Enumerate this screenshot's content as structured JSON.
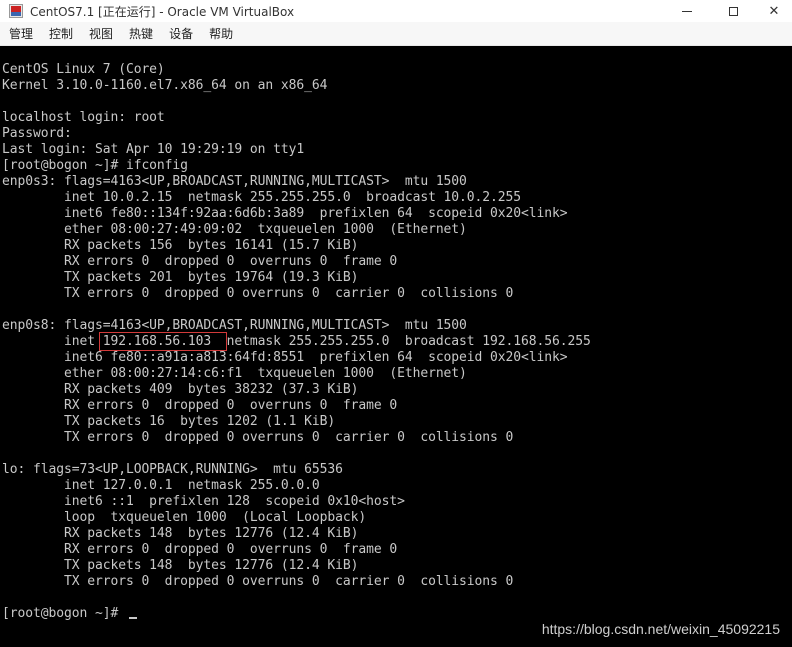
{
  "window": {
    "title": "CentOS7.1 [正在运行] - Oracle VM VirtualBox",
    "controls": {
      "minimize": "—",
      "maximize": "☐",
      "close": "✕"
    }
  },
  "menu": {
    "items": [
      "管理",
      "控制",
      "视图",
      "热键",
      "设备",
      "帮助"
    ]
  },
  "console": {
    "lines": [
      "CentOS Linux 7 (Core)",
      "Kernel 3.10.0-1160.el7.x86_64 on an x86_64",
      "",
      "localhost login: root",
      "Password:",
      "Last login: Sat Apr 10 19:29:19 on tty1",
      "[root@bogon ~]# ifconfig",
      "enp0s3: flags=4163<UP,BROADCAST,RUNNING,MULTICAST>  mtu 1500",
      "        inet 10.0.2.15  netmask 255.255.255.0  broadcast 10.0.2.255",
      "        inet6 fe80::134f:92aa:6d6b:3a89  prefixlen 64  scopeid 0x20<link>",
      "        ether 08:00:27:49:09:02  txqueuelen 1000  (Ethernet)",
      "        RX packets 156  bytes 16141 (15.7 KiB)",
      "        RX errors 0  dropped 0  overruns 0  frame 0",
      "        TX packets 201  bytes 19764 (19.3 KiB)",
      "        TX errors 0  dropped 0 overruns 0  carrier 0  collisions 0",
      "",
      "enp0s8: flags=4163<UP,BROADCAST,RUNNING,MULTICAST>  mtu 1500",
      "        inet 192.168.56.103  netmask 255.255.255.0  broadcast 192.168.56.255",
      "        inet6 fe80::a91a:a813:64fd:8551  prefixlen 64  scopeid 0x20<link>",
      "        ether 08:00:27:14:c6:f1  txqueuelen 1000  (Ethernet)",
      "        RX packets 409  bytes 38232 (37.3 KiB)",
      "        RX errors 0  dropped 0  overruns 0  frame 0",
      "        TX packets 16  bytes 1202 (1.1 KiB)",
      "        TX errors 0  dropped 0 overruns 0  carrier 0  collisions 0",
      "",
      "lo: flags=73<UP,LOOPBACK,RUNNING>  mtu 65536",
      "        inet 127.0.0.1  netmask 255.0.0.0",
      "        inet6 ::1  prefixlen 128  scopeid 0x10<host>",
      "        loop  txqueuelen 1000  (Local Loopback)",
      "        RX packets 148  bytes 12776 (12.4 KiB)",
      "        RX errors 0  dropped 0  overruns 0  frame 0",
      "        TX packets 148  bytes 12776 (12.4 KiB)",
      "        TX errors 0  dropped 0 overruns 0  carrier 0  collisions 0",
      "",
      "[root@bogon ~]#"
    ]
  },
  "watermark": "https://blog.csdn.net/weixin_45092215",
  "colors": {
    "terminal_bg": "#000000",
    "terminal_fg": "#c8c8c8",
    "highlight": "#d23a3a"
  }
}
